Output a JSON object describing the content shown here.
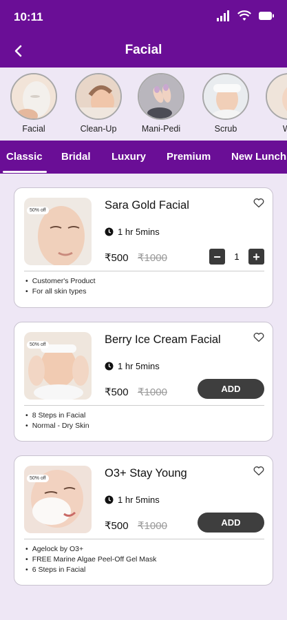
{
  "status": {
    "time": "10:11"
  },
  "header": {
    "title": "Facial"
  },
  "categories": [
    {
      "label": "Facial"
    },
    {
      "label": "Clean-Up"
    },
    {
      "label": "Mani-Pedi"
    },
    {
      "label": "Scrub"
    },
    {
      "label": "Wa"
    }
  ],
  "tabs": [
    {
      "label": "Classic",
      "active": true
    },
    {
      "label": "Bridal"
    },
    {
      "label": "Luxury"
    },
    {
      "label": "Premium"
    },
    {
      "label": "New Lunch"
    }
  ],
  "services": [
    {
      "name": "Sara Gold Facial",
      "duration": "1 hr 5mins",
      "price": "₹500",
      "mrp": "₹1000",
      "badge": "50% off",
      "quantity": "1",
      "features": [
        "Customer's Product",
        "For all skin types"
      ]
    },
    {
      "name": "Berry Ice Cream Facial",
      "duration": "1 hr 5mins",
      "price": "₹500",
      "mrp": "₹1000",
      "badge": "50% off",
      "add_label": "ADD",
      "features": [
        "8 Steps in Facial",
        "Normal - Dry Skin"
      ]
    },
    {
      "name": "O3+ Stay Young",
      "duration": "1 hr 5mins",
      "price": "₹500",
      "mrp": "₹1000",
      "badge": "50% off",
      "add_label": "ADD",
      "features": [
        "Agelock by O3+",
        "FREE Marine Algae Peel-Off Gel Mask",
        "6 Steps in Facial"
      ]
    }
  ],
  "colors": {
    "primary": "#6a0e96",
    "background": "#eee7f5",
    "button": "#3e3e3e"
  }
}
